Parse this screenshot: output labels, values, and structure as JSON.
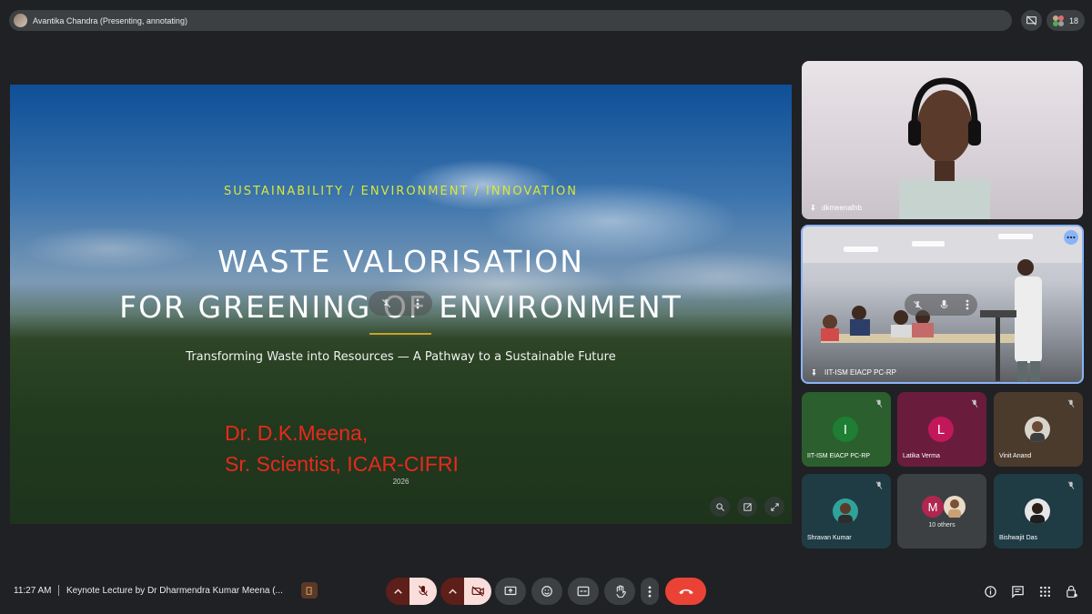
{
  "topbar": {
    "presenter_label": "Avantika Chandra (Presenting, annotating)",
    "participant_count": "18",
    "present_icon": "present-to-all-off-icon",
    "people_icon": "people-icon"
  },
  "slide": {
    "tagline": "SUSTAINABILITY / ENVIRONMENT / INNOVATION",
    "title_line1": "WASTE VALORISATION",
    "title_line2": "FOR GREENING OF ENVIRONMENT",
    "subtitle": "Transforming Waste into Resources — A Pathway to a Sustainable Future",
    "author_line1": "Dr. D.K.Meena,",
    "author_line2": "Sr. Scientist, ICAR-CIFRI",
    "year": "2026",
    "colors": {
      "tagline": "#d9e63a",
      "author": "#e8291c",
      "divider": "#c9a227"
    }
  },
  "tiles": {
    "featured_1": {
      "name": "dkmeenafnb"
    },
    "featured_2": {
      "name": "IIT-ISM EIACP PC-RP"
    },
    "grid": [
      {
        "name": "IIT-ISM EIACP PC-RP",
        "initial": "I",
        "avatar_color": "#1e7e34"
      },
      {
        "name": "Latika Verma",
        "initial": "L",
        "avatar_color": "#c2185b"
      },
      {
        "name": "Vinit Anand"
      },
      {
        "name": "Shravan Kumar"
      },
      {
        "label": "10 others",
        "initial": "M",
        "avatar_color": "#b0264f"
      },
      {
        "name": "Bishwajit Das"
      }
    ]
  },
  "bottombar": {
    "time": "11:27 AM",
    "meeting_title": "Keynote Lecture by Dr Dharmendra Kumar Meena (...",
    "colors": {
      "end_call": "#ea4335",
      "muted_bg": "#f9dedc"
    }
  }
}
